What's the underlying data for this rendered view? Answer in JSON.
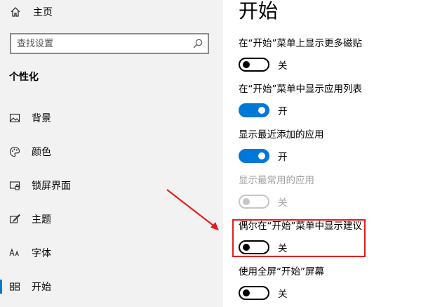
{
  "sidebar": {
    "home_label": "主页",
    "search_placeholder": "查找设置",
    "section_title": "个性化",
    "items": [
      {
        "label": "背景",
        "icon": "picture-icon"
      },
      {
        "label": "颜色",
        "icon": "palette-icon"
      },
      {
        "label": "锁屏界面",
        "icon": "lock-screen-icon"
      },
      {
        "label": "主题",
        "icon": "theme-brush-icon"
      },
      {
        "label": "字体",
        "icon": "font-icon"
      },
      {
        "label": "开始",
        "icon": "start-menu-icon",
        "active": true
      }
    ]
  },
  "main": {
    "title": "开始",
    "settings": [
      {
        "label": "在“开始”菜单上显示更多磁贴",
        "state": "关",
        "on": false,
        "disabled": false
      },
      {
        "label": "在“开始”菜单中显示应用列表",
        "state": "开",
        "on": true,
        "disabled": false
      },
      {
        "label": "显示最近添加的应用",
        "state": "开",
        "on": true,
        "disabled": false
      },
      {
        "label": "显示最常用的应用",
        "state": "关",
        "on": false,
        "disabled": true
      },
      {
        "label": "偶尔在“开始”菜单中显示建议",
        "state": "关",
        "on": false,
        "disabled": false
      },
      {
        "label": "使用全屏“开始”屏幕",
        "state": "关",
        "on": false,
        "disabled": false
      }
    ]
  },
  "colors": {
    "accent": "#0078d7",
    "annotation": "#e41e1e"
  }
}
